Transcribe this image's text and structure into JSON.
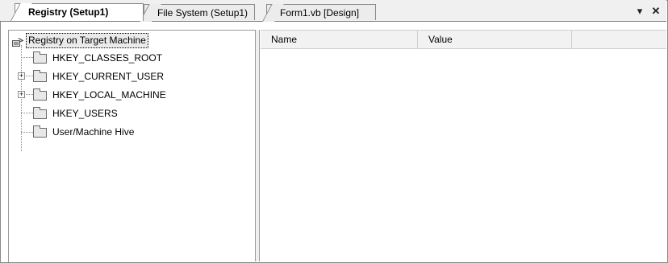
{
  "tabs": [
    {
      "label": "Registry (Setup1)",
      "active": true
    },
    {
      "label": "File System (Setup1)",
      "active": false
    },
    {
      "label": "Form1.vb [Design]",
      "active": false
    }
  ],
  "tab_controls": {
    "dropdown_icon": "▾",
    "close_icon": "✕"
  },
  "tree": {
    "root": "Registry on Target Machine",
    "items": [
      {
        "label": "HKEY_CLASSES_ROOT",
        "expandable": false
      },
      {
        "label": "HKEY_CURRENT_USER",
        "expandable": true
      },
      {
        "label": "HKEY_LOCAL_MACHINE",
        "expandable": true
      },
      {
        "label": "HKEY_USERS",
        "expandable": false
      },
      {
        "label": "User/Machine Hive",
        "expandable": false
      }
    ]
  },
  "list": {
    "columns": [
      "Name",
      "Value"
    ]
  }
}
